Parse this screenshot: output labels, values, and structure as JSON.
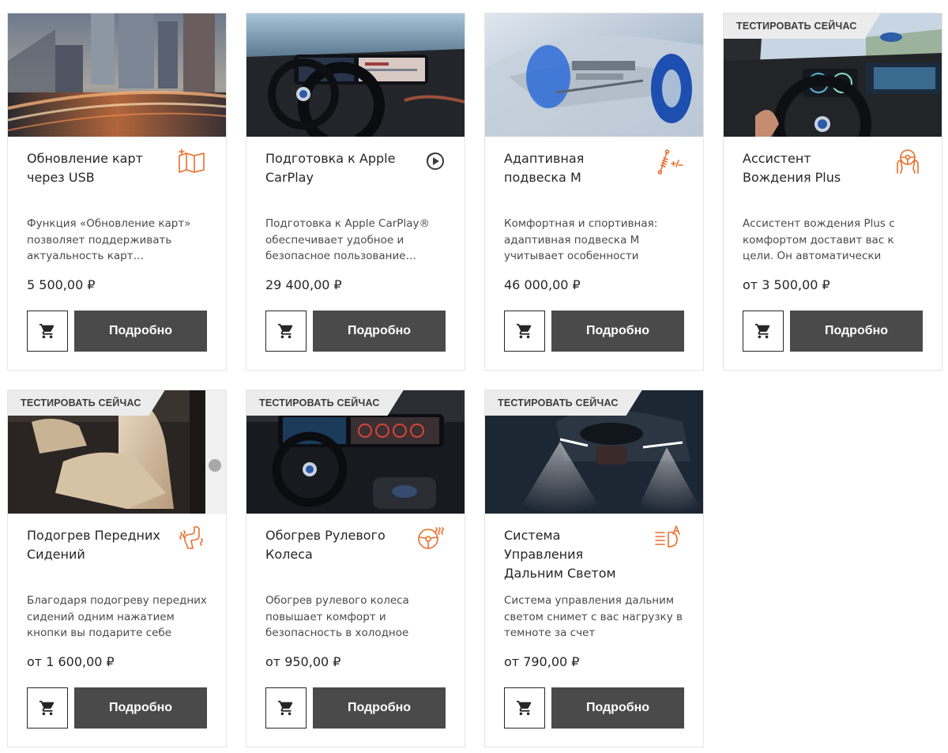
{
  "accent_color": "#e96f2c",
  "cards": [
    {
      "title": "Обновление карт через USB",
      "description": "Функция «Обновление карт» позволяет поддерживать актуальность карт…",
      "price": "5 500,00 ₽",
      "badge": "",
      "icon": "map-update-icon",
      "image": "city-night-road",
      "cart_icon": "cart-icon",
      "button_label": "Подробно"
    },
    {
      "title": "Подготовка к Apple CarPlay",
      "description": "Подготовка к Apple CarPlay® обеспечивает удобное и безопасное пользование…",
      "price": "29 400,00 ₽",
      "badge": "",
      "icon": "play-icon",
      "image": "car-dashboard",
      "cart_icon": "cart-icon",
      "button_label": "Подробно"
    },
    {
      "title": "Адаптивная подвеска M",
      "description": "Комфортная и спортивная: адаптивная подвеска M учитывает особенности вашего…",
      "price": "46 000,00 ₽",
      "badge": "",
      "icon": "suspension-icon",
      "image": "suspension-xray",
      "cart_icon": "cart-icon",
      "button_label": "Подробно"
    },
    {
      "title": "Ассистент Вождения Plus",
      "description": "Ассистент вождения Plus с комфортом доставит вас к цели. Он автоматически поддержива…",
      "price": "от 3 500,00 ₽",
      "badge": "ТЕСТИРОВАТЬ СЕЙЧАС",
      "icon": "driving-assistant-icon",
      "image": "cockpit-highway",
      "cart_icon": "cart-icon",
      "button_label": "Подробно"
    },
    {
      "title": "Подогрев Передних Сидений",
      "description": "Благодаря подогреву передних сидений одним нажатием кнопки вы подарите себе комфорт.…",
      "price": "от 1 600,00 ₽",
      "badge": "ТЕСТИРОВАТЬ СЕЙЧАС",
      "icon": "heated-seat-icon",
      "image": "beige-seats",
      "cart_icon": "cart-icon",
      "button_label": "Подробно"
    },
    {
      "title": "Обогрев Рулевого Колеса",
      "description": "Обогрев рулевого колеса повышает комфорт и безопасность в холодное время…",
      "price": "от 950,00 ₽",
      "badge": "ТЕСТИРОВАТЬ СЕЙЧАС",
      "icon": "heated-steering-wheel-icon",
      "image": "dashboard-interior",
      "cart_icon": "cart-icon",
      "button_label": "Подробно"
    },
    {
      "title": "Система Управления Дальним Светом",
      "description": "Система управления дальним светом снимет с вас нагрузку в темноте за счет автоматическо…",
      "price": "от 790,00 ₽",
      "badge": "ТЕСТИРОВАТЬ СЕЙЧАС",
      "icon": "high-beam-icon",
      "image": "car-headlights-dark",
      "cart_icon": "cart-icon",
      "button_label": "Подробно"
    }
  ]
}
